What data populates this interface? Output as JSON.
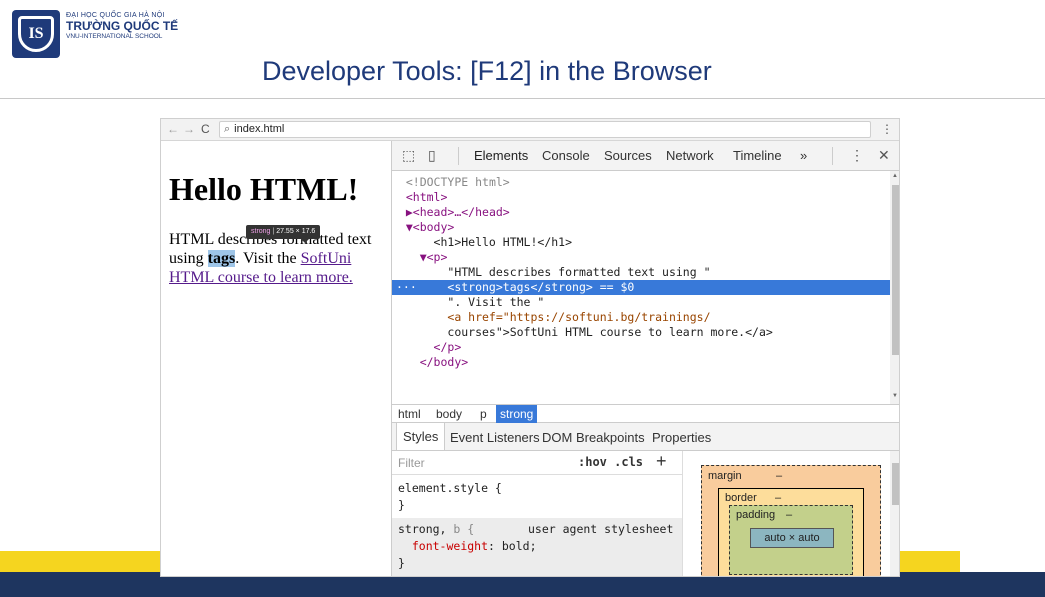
{
  "slide": {
    "logo_text": "IS",
    "school_line1": "ĐẠI HỌC QUỐC GIA HÀ NỘI",
    "school_line2": "TRƯỜNG QUỐC TẾ",
    "school_line3": "VNU-INTERNATIONAL SCHOOL",
    "title": "Developer Tools: [F12] in the Browser"
  },
  "browser": {
    "back": "←",
    "forward": "→",
    "reload": "C",
    "search_glyph": "⌕",
    "url": "index.html",
    "menu": "⋮"
  },
  "page": {
    "heading": "Hello HTML!",
    "para_before": "HTML describes formatted text using ",
    "strong_text": "tags",
    "para_mid": ". Visit the ",
    "link_text": "SoftUni HTML course to learn more.",
    "tooltip_tag": "strong",
    "tooltip_sep": "|",
    "tooltip_dims": "27.55 × 17.6"
  },
  "devtools": {
    "inspect_icon": "⬚",
    "device_icon": "▯",
    "tabs": [
      "Elements",
      "Console",
      "Sources",
      "Network",
      "Timeline"
    ],
    "more": "»",
    "kebab": "⋮",
    "close": "✕",
    "selected_marker": "···",
    "code_lines": [
      {
        "indent": "  ",
        "text": "<!DOCTYPE html>"
      },
      {
        "indent": "  ",
        "text": "<html>"
      },
      {
        "indent": "  ",
        "text": "▶<head>…</head>"
      },
      {
        "indent": "  ",
        "text": "▼<body>"
      },
      {
        "indent": "      ",
        "text": "<h1>Hello HTML!</h1>"
      },
      {
        "indent": "    ",
        "text": "▼<p>"
      },
      {
        "indent": "        ",
        "text": "\"HTML describes formatted text using \""
      },
      {
        "indent": "        ",
        "text": "<strong>tags</strong> == $0"
      },
      {
        "indent": "        ",
        "text": "\". Visit the \""
      },
      {
        "indent": "        ",
        "text": "<a href=\"https://softuni.bg/trainings/"
      },
      {
        "indent": "        ",
        "text": "courses\">SoftUni HTML course to learn more.</a>"
      },
      {
        "indent": "      ",
        "text": "</p>"
      },
      {
        "indent": "    ",
        "text": "</body>"
      }
    ],
    "breadcrumbs": [
      "html",
      "body",
      "p",
      "strong"
    ],
    "subtabs": [
      "Styles",
      "Event Listeners",
      "DOM Breakpoints",
      "Properties"
    ],
    "filter_placeholder": "Filter",
    "hov_cls": ":hov  .cls",
    "plus": "+",
    "styles": {
      "element_style": "element.style {",
      "close1": "}",
      "selector": "strong, ",
      "selector_dim": "b {",
      "ua_label": "user agent stylesheet",
      "prop_name": "font-weight",
      "prop_value": ": bold;",
      "close2": "}"
    },
    "box_model": {
      "margin": "margin",
      "border": "border",
      "padding": "padding",
      "dash": "–",
      "content": "auto × auto"
    }
  },
  "colors": {
    "title_blue": "#1f3a7a",
    "bottom_band": "#1e355f",
    "yellow": "#f5d51f",
    "selection_blue": "#3879d9"
  }
}
